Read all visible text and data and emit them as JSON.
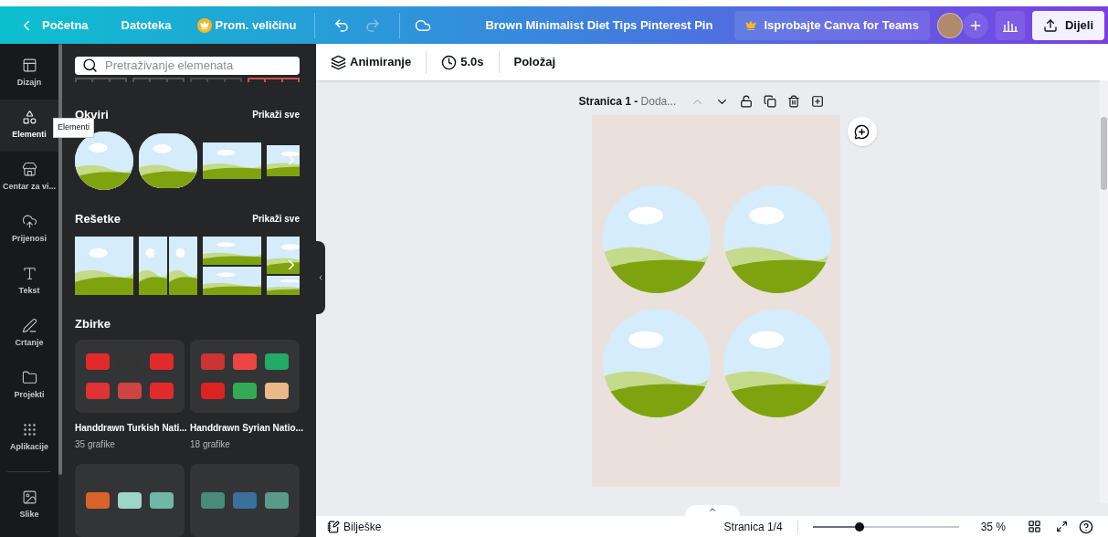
{
  "header": {
    "back": "Početna",
    "file": "Datoteka",
    "resize": "Prom. veličinu",
    "title": "Brown Minimalist Diet Tips Pinterest Pin",
    "teams": "Isprobajte Canva for Teams",
    "share": "Dijeli"
  },
  "rail": [
    {
      "kind": "layout",
      "label": "Dizajn",
      "selected": false
    },
    {
      "kind": "shapes",
      "label": "Elementi",
      "selected": true
    },
    {
      "kind": "store",
      "label": "Centar za vi...",
      "selected": false
    },
    {
      "kind": "upload",
      "label": "Prijenosi",
      "selected": false
    },
    {
      "kind": "text",
      "label": "Tekst",
      "selected": false
    },
    {
      "kind": "draw",
      "label": "Crtanje",
      "selected": false
    },
    {
      "kind": "folder",
      "label": "Projekti",
      "selected": false
    },
    {
      "kind": "apps",
      "label": "Aplikacije",
      "selected": false
    },
    {
      "kind": "image",
      "label": "Slike",
      "selected": false
    }
  ],
  "tooltip": "Elementi",
  "search": {
    "placeholder": "Pretraživanje elemenata"
  },
  "sections": [
    {
      "kind": "frames",
      "title": "Okviri",
      "link": "Prikaži sve"
    },
    {
      "kind": "grids",
      "title": "Rešetke",
      "link": "Prikaži sve"
    }
  ],
  "collections": {
    "title": "Zbirke",
    "items": [
      {
        "title": "Handdrawn Turkish Nati...",
        "count": "35 grafike"
      },
      {
        "title": "Handdrawn Syrian Natio...",
        "count": "18 grafike"
      }
    ]
  },
  "toolbar": {
    "animate": "Animiranje",
    "duration": "5.0s",
    "position": "Položaj"
  },
  "page": {
    "name": "Stranica 1 -",
    "subtitle": "Doda..."
  },
  "footer": {
    "notes": "Bilješke",
    "page": "Stranica 1/4",
    "zoom": {
      "level": 0.32,
      "reading": "35 %"
    }
  }
}
